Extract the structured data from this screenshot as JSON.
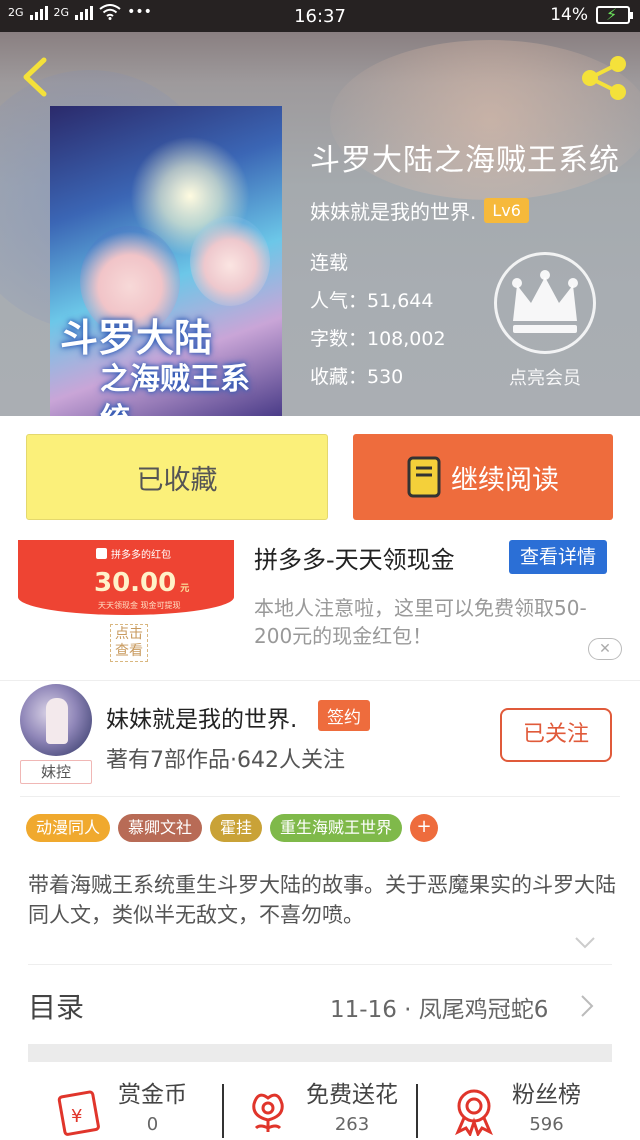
{
  "status_bar": {
    "network1": "2G",
    "network2": "2G",
    "dots": "•••",
    "time": "16:37",
    "battery": "14%"
  },
  "book": {
    "title": "斗罗大陆之海贼王系统",
    "author": "妹妹就是我的世界.",
    "level": "Lv6",
    "status": "连载",
    "popularity": "人气：51,644",
    "word_count": "字数：108,002",
    "favorites": "收藏：530",
    "vip_label": "点亮会员",
    "cover_title_line1": "斗罗大陆",
    "cover_title_line2": "之海贼王系统"
  },
  "actions": {
    "collected": "已收藏",
    "continue_read": "继续阅读"
  },
  "ad": {
    "title": "拼多多-天天领现金",
    "detail_button": "查看详情",
    "description": "本地人注意啦，这里可以免费领取50-200元的现金红包！",
    "image_brand": "拼多多的红包",
    "image_amount": "30.00",
    "image_unit": "元",
    "image_small": "天天领现金 现金可提现",
    "image_button": "点击查看"
  },
  "author_card": {
    "name": "妹妹就是我的世界.",
    "sign_badge": "签约",
    "stats": "著有7部作品·642人关注",
    "avatar_tag": "妹控",
    "follow_button": "已关注"
  },
  "tags": [
    {
      "label": "动漫同人",
      "color": "#f0a92e"
    },
    {
      "label": "慕卿文社",
      "color": "#b86b56"
    },
    {
      "label": "霍挂",
      "color": "#c9a237"
    },
    {
      "label": "重生海贼王世界",
      "color": "#7fb94a"
    }
  ],
  "tag_add": "+",
  "description": "带着海贼王系统重生斗罗大陆的故事。关于恶魔果实的斗罗大陆同人文，类似半无敌文，不喜勿喷。",
  "toc": {
    "label": "目录",
    "latest": "11-16 · 凤尾鸡冠蛇6"
  },
  "bottom": {
    "reward": {
      "label": "赏金币",
      "value": "0"
    },
    "flowers": {
      "label": "免费送花",
      "value": "263"
    },
    "fans": {
      "label": "粉丝榜",
      "value": "596"
    }
  },
  "colors": {
    "accent_orange": "#ee6c3d",
    "collect_yellow": "#fbf07a",
    "ad_blue": "#2b6fd6",
    "level_badge": "#f6b93b"
  }
}
